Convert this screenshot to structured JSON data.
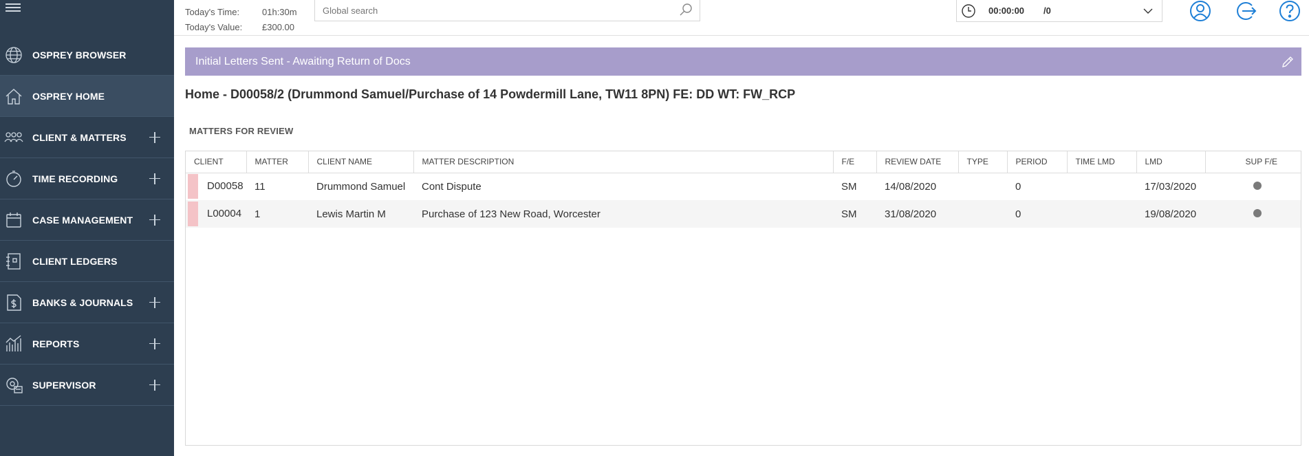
{
  "sidebar": {
    "items": [
      {
        "label": "OSPREY BROWSER",
        "icon": "globe-www-icon",
        "expandable": false,
        "active": false
      },
      {
        "label": "OSPREY HOME",
        "icon": "home-icon",
        "expandable": false,
        "active": true
      },
      {
        "label": "CLIENT & MATTERS",
        "icon": "people-group-icon",
        "expandable": true,
        "active": false
      },
      {
        "label": "TIME RECORDING",
        "icon": "stopwatch-icon",
        "expandable": true,
        "active": false
      },
      {
        "label": "CASE MANAGEMENT",
        "icon": "calendar-icon",
        "expandable": true,
        "active": false
      },
      {
        "label": "CLIENT LEDGERS",
        "icon": "ledger-book-icon",
        "expandable": false,
        "active": false
      },
      {
        "label": "BANKS & JOURNALS",
        "icon": "money-document-icon",
        "expandable": true,
        "active": false
      },
      {
        "label": "REPORTS",
        "icon": "bar-chart-icon",
        "expandable": true,
        "active": false
      },
      {
        "label": "SUPERVISOR",
        "icon": "supervisor-gear-icon",
        "expandable": true,
        "active": false
      }
    ]
  },
  "header": {
    "today_time_label": "Today's Time:",
    "today_time_value": "01h:30m",
    "today_value_label": "Today's Value:",
    "today_value_value": "£300.00",
    "search_placeholder": "Global search",
    "timer_value": "00:00:00",
    "timer_count": "/0"
  },
  "banner": {
    "text": "Initial Letters Sent - Awaiting Return of Docs"
  },
  "page": {
    "title": "Home - D00058/2 (Drummond  Samuel/Purchase of 14 Powdermill Lane, TW11 8PN) FE: DD WT: FW_RCP",
    "section_title": "MATTERS FOR REVIEW"
  },
  "table": {
    "columns": [
      "CLIENT",
      "MATTER",
      "CLIENT NAME",
      "MATTER DESCRIPTION",
      "F/E",
      "REVIEW DATE",
      "TYPE",
      "PERIOD",
      "TIME LMD",
      "LMD",
      "SUP F/E"
    ],
    "rows": [
      {
        "client": "D00058",
        "matter": "11",
        "client_name": "Drummond Samuel",
        "description": "Cont Dispute",
        "fe": "SM",
        "review_date": "14/08/2020",
        "type": "",
        "period": "0",
        "time_lmd": "",
        "lmd": "17/03/2020"
      },
      {
        "client": "L00004",
        "matter": "1",
        "client_name": "Lewis Martin M",
        "description": "Purchase of 123 New Road, Worcester",
        "fe": "SM",
        "review_date": "31/08/2020",
        "type": "",
        "period": "0",
        "time_lmd": "",
        "lmd": "19/08/2020"
      }
    ]
  },
  "colors": {
    "sidebar_bg": "#2d3e50",
    "banner_bg": "#a79dcb",
    "accent_blue": "#1e7fd6",
    "row_flag": "#f4c3c7"
  }
}
